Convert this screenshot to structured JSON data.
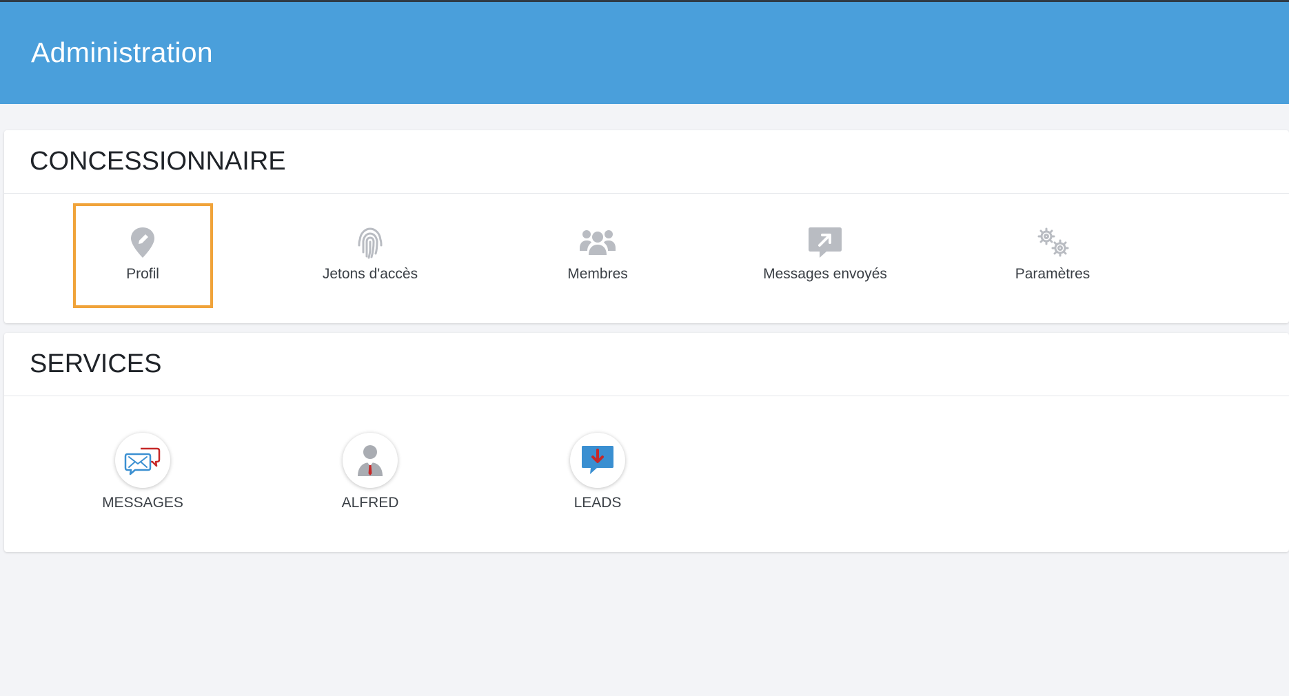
{
  "header": {
    "title": "Administration"
  },
  "colors": {
    "header_bg": "#4a9fdb",
    "selection": "#f0a33a",
    "icon_gray": "#b9bcc2"
  },
  "dealer": {
    "heading": "CONCESSIONNAIRE",
    "selected_item": "profil",
    "items": [
      {
        "label": "Profil",
        "icon": "location-pin-pencil-icon"
      },
      {
        "label": "Jetons d'accès",
        "icon": "fingerprint-icon"
      },
      {
        "label": "Membres",
        "icon": "users-group-icon"
      },
      {
        "label": "Messages envoyés",
        "icon": "share-arrow-icon"
      },
      {
        "label": "Paramètres",
        "icon": "gears-icon"
      }
    ]
  },
  "services": {
    "heading": "SERVICES",
    "items": [
      {
        "label": "MESSAGES",
        "icon": "chat-envelope-icon"
      },
      {
        "label": "ALFRED",
        "icon": "person-tie-icon"
      },
      {
        "label": "LEADS",
        "icon": "download-bubble-icon"
      }
    ]
  }
}
